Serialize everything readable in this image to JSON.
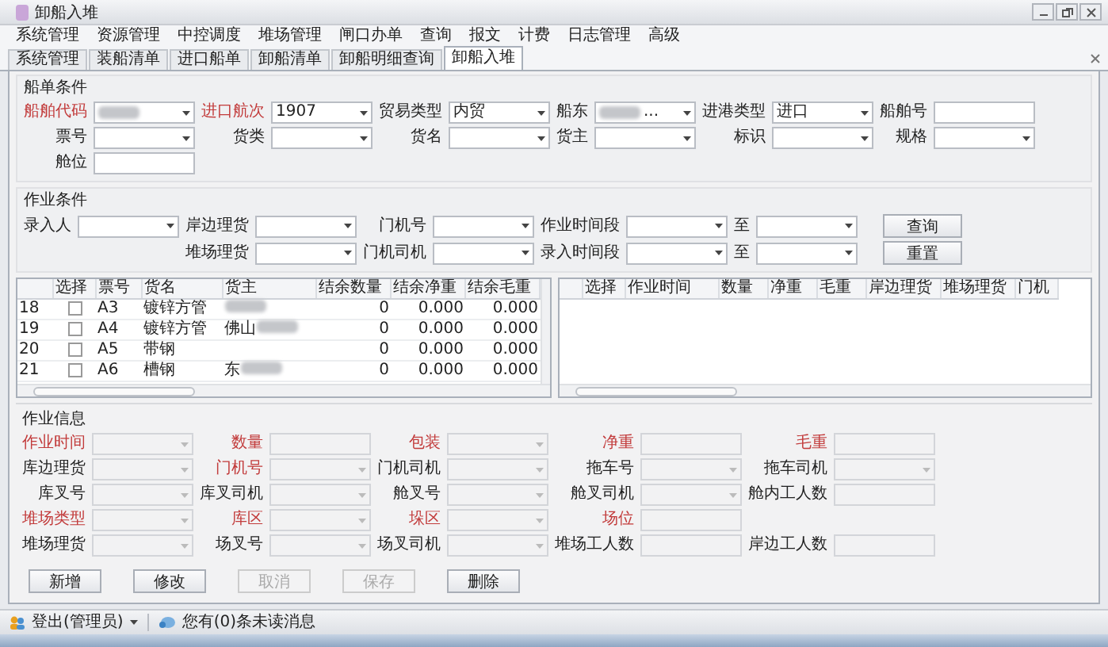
{
  "window": {
    "title": "卸船入堆"
  },
  "menu": [
    "系统管理",
    "资源管理",
    "中控调度",
    "堆场管理",
    "闸口办单",
    "查询",
    "报文",
    "计费",
    "日志管理",
    "高级"
  ],
  "tabs": [
    {
      "label": "系统管理",
      "selected": false
    },
    {
      "label": "装船清单",
      "selected": false
    },
    {
      "label": "进口船单",
      "selected": false
    },
    {
      "label": "卸船清单",
      "selected": false
    },
    {
      "label": "卸船明细查询",
      "selected": false
    },
    {
      "label": "卸船入堆",
      "selected": true
    }
  ],
  "ship_conditions": {
    "title": "船单条件",
    "rows": [
      [
        {
          "label": "船舶代码",
          "required": true,
          "kind": "combo",
          "blurred": true
        },
        {
          "label": "进口航次",
          "required": true,
          "kind": "combo",
          "value": "1907"
        },
        {
          "label": "贸易类型",
          "required": false,
          "kind": "combo",
          "value": "内贸"
        },
        {
          "label": "船东",
          "required": false,
          "kind": "combo",
          "blurred": true,
          "value": "..."
        },
        {
          "label": "进港类型",
          "required": false,
          "kind": "combo",
          "value": "进口"
        },
        {
          "label": "船舶号",
          "required": false,
          "kind": "text"
        }
      ],
      [
        {
          "label": "票号",
          "required": false,
          "kind": "combo"
        },
        {
          "label": "货类",
          "required": false,
          "kind": "combo"
        },
        {
          "label": "货名",
          "required": false,
          "kind": "combo"
        },
        {
          "label": "货主",
          "required": false,
          "kind": "combo"
        },
        {
          "label": "标识",
          "required": false,
          "kind": "combo"
        },
        {
          "label": "规格",
          "required": false,
          "kind": "combo"
        }
      ],
      [
        {
          "label": "舱位",
          "required": false,
          "kind": "text"
        }
      ]
    ]
  },
  "work_conditions": {
    "title": "作业条件",
    "rows": [
      [
        {
          "label": "录入人",
          "required": false,
          "kind": "combo"
        },
        {
          "label": "岸边理货",
          "required": false,
          "kind": "combo"
        },
        {
          "label": "门机号",
          "required": false,
          "kind": "combo"
        },
        {
          "label": "作业时间段",
          "required": false,
          "kind": "combo"
        },
        {
          "label": "至",
          "required": false,
          "kind": "combo"
        },
        {
          "label": "查询",
          "kind": "button"
        }
      ],
      [
        {
          "kind": "empty"
        },
        {
          "label": "堆场理货",
          "required": false,
          "kind": "combo"
        },
        {
          "label": "门机司机",
          "required": false,
          "kind": "combo"
        },
        {
          "label": "录入时间段",
          "required": false,
          "kind": "combo"
        },
        {
          "label": "至",
          "required": false,
          "kind": "combo"
        },
        {
          "label": "重置",
          "kind": "button"
        }
      ]
    ]
  },
  "cargo_table": {
    "columns": [
      "",
      "选择",
      "票号",
      "货名",
      "货主",
      "结余数量",
      "结余净重",
      "结余毛重"
    ],
    "rows": [
      {
        "number": "18",
        "checked": false,
        "ticket": "A3",
        "cargo": "镀锌方管",
        "owner": "",
        "owner_blurred": true,
        "quantity": "0",
        "net": "0.000",
        "gross": "0.000"
      },
      {
        "number": "19",
        "checked": false,
        "ticket": "A4",
        "cargo": "镀锌方管",
        "owner": "佛山",
        "owner_blurred": true,
        "quantity": "0",
        "net": "0.000",
        "gross": "0.000"
      },
      {
        "number": "20",
        "checked": false,
        "ticket": "A5",
        "cargo": "带钢",
        "owner": "",
        "owner_blurred": false,
        "quantity": "0",
        "net": "0.000",
        "gross": "0.000"
      },
      {
        "number": "21",
        "checked": false,
        "ticket": "A6",
        "cargo": "槽钢",
        "owner": "东",
        "owner_blurred": true,
        "quantity": "0",
        "net": "0.000",
        "gross": "0.000"
      }
    ]
  },
  "work_table": {
    "columns": [
      "",
      "选择",
      "作业时间",
      "数量",
      "净重",
      "毛重",
      "岸边理货",
      "堆场理货",
      "门机"
    ]
  },
  "work_info": {
    "title": "作业信息",
    "disabled": true,
    "rows": [
      [
        {
          "label": "作业时间",
          "required": true,
          "kind": "combo"
        },
        {
          "label": "数量",
          "required": true,
          "kind": "text"
        },
        {
          "label": "包装",
          "required": true,
          "kind": "combo"
        },
        {
          "label": "净重",
          "required": true,
          "kind": "text"
        },
        {
          "label": "毛重",
          "required": true,
          "kind": "text"
        }
      ],
      [
        {
          "label": "库边理货",
          "required": false,
          "kind": "combo"
        },
        {
          "label": "门机号",
          "required": true,
          "kind": "combo"
        },
        {
          "label": "门机司机",
          "required": false,
          "kind": "combo"
        },
        {
          "label": "拖车号",
          "required": false,
          "kind": "combo"
        },
        {
          "label": "拖车司机",
          "required": false,
          "kind": "combo"
        }
      ],
      [
        {
          "label": "库叉号",
          "required": false,
          "kind": "combo"
        },
        {
          "label": "库叉司机",
          "required": false,
          "kind": "combo"
        },
        {
          "label": "舱叉号",
          "required": false,
          "kind": "combo"
        },
        {
          "label": "舱叉司机",
          "required": false,
          "kind": "combo"
        },
        {
          "label": "舱内工人数",
          "required": false,
          "kind": "text"
        }
      ],
      [
        {
          "label": "堆场类型",
          "required": true,
          "kind": "combo"
        },
        {
          "label": "库区",
          "required": true,
          "kind": "combo"
        },
        {
          "label": "垛区",
          "required": true,
          "kind": "combo"
        },
        {
          "label": "场位",
          "required": true,
          "kind": "text"
        }
      ],
      [
        {
          "label": "堆场理货",
          "required": false,
          "kind": "combo"
        },
        {
          "label": "场叉号",
          "required": false,
          "kind": "combo"
        },
        {
          "label": "场叉司机",
          "required": false,
          "kind": "combo"
        },
        {
          "label": "堆场工人数",
          "required": false,
          "kind": "text"
        },
        {
          "label": "岸边工人数",
          "required": false,
          "kind": "text"
        }
      ]
    ]
  },
  "actions": [
    {
      "label": "新增",
      "disabled": false
    },
    {
      "label": "修改",
      "disabled": false
    },
    {
      "label": "取消",
      "disabled": true
    },
    {
      "label": "保存",
      "disabled": true
    },
    {
      "label": "删除",
      "disabled": false
    }
  ],
  "status_bar": {
    "user": "登出(管理员)",
    "messages": "您有(0)条未读消息"
  }
}
